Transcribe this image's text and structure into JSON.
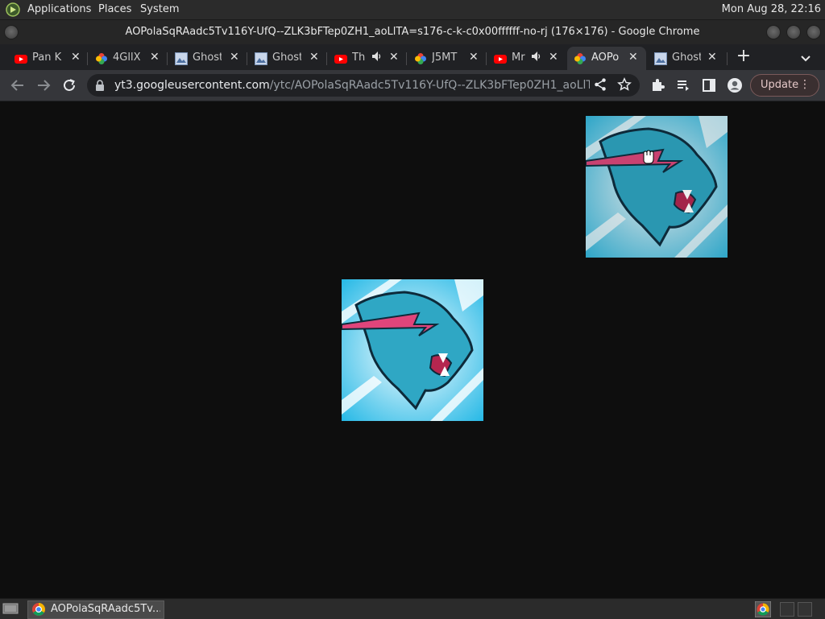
{
  "panel": {
    "applications_label": "Applications",
    "places_label": "Places",
    "system_label": "System",
    "clock": "Mon Aug 28, 22:16"
  },
  "window": {
    "title": "AOPolaSqRAadc5Tv116Y-UfQ--ZLK3bFTep0ZH1_aoLlTA=s176-c-k-c0x00ffffff-no-rj (176×176) - Google Chrome"
  },
  "tabs": [
    {
      "label": "Pan K",
      "icon": "youtube-icon",
      "active": false
    },
    {
      "label": "4GllX",
      "icon": "google-photos-icon",
      "active": false
    },
    {
      "label": "Ghost",
      "icon": "image-icon",
      "active": false
    },
    {
      "label": "Ghost",
      "icon": "image-icon",
      "active": false
    },
    {
      "label": "Th",
      "icon": "youtube-icon",
      "audio": true,
      "active": false
    },
    {
      "label": "J5MT",
      "icon": "google-photos-icon",
      "active": false
    },
    {
      "label": "Mr",
      "icon": "youtube-icon",
      "audio": true,
      "active": false
    },
    {
      "label": "AOPo",
      "icon": "google-photos-icon",
      "active": true
    },
    {
      "label": "Ghost",
      "icon": "image-icon",
      "active": false
    }
  ],
  "toolbar": {
    "url_host": "yt3.googleusercontent.com",
    "url_path": "/ytc/AOPolaSqRAadc5Tv116Y-UfQ--ZLK3bFTep0ZH1_aoLlTA=s...",
    "update_label": "Update"
  },
  "images": {
    "primary_alt_icon": "mrbeast-panther-logo",
    "secondary_alt_icon": "mrbeast-panther-logo"
  },
  "taskbar": {
    "task_label": "AOPolaSqRAadc5Tv..."
  },
  "colors": {
    "tab_bg": "#202124",
    "active_tab_bg": "#35363a",
    "content_bg": "#0e0e0e",
    "logo_teal": "#2fa7c4",
    "logo_pink": "#e0457b"
  }
}
